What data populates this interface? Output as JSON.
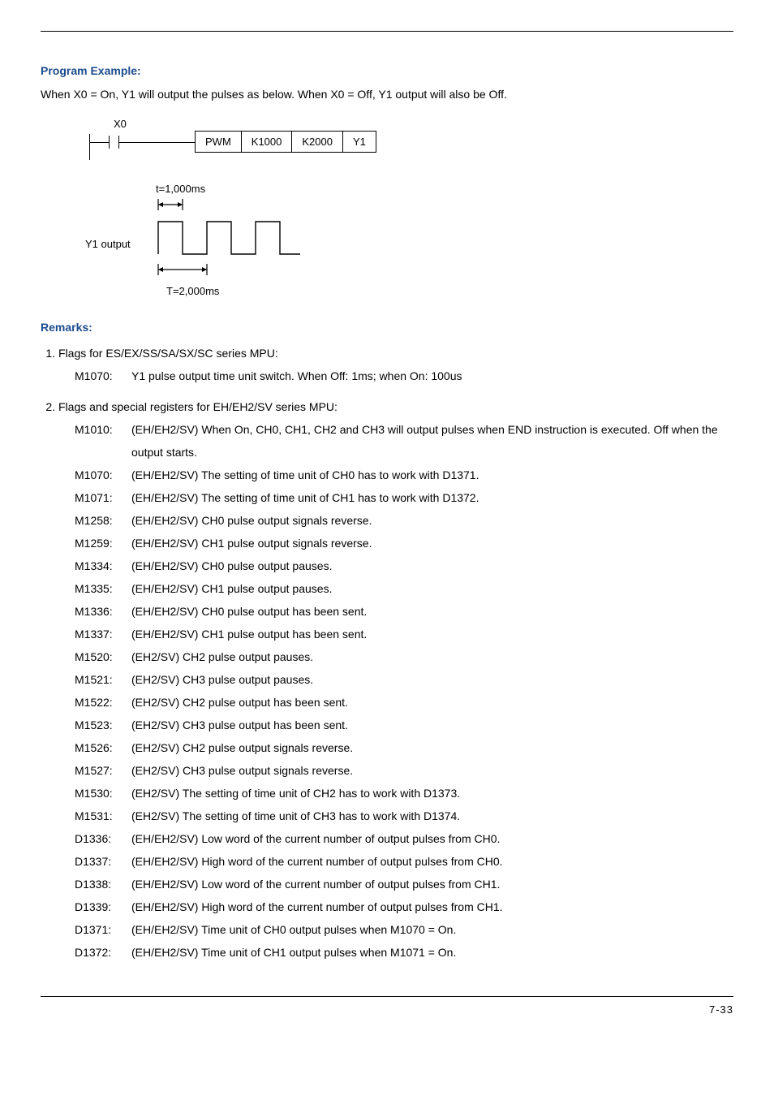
{
  "section": {
    "example_heading": "Program Example:",
    "intro_text": "When X0 = On, Y1 will output the pulses as below. When X0 = Off, Y1 output will also be Off.",
    "remarks_heading": "Remarks:"
  },
  "ladder": {
    "x0_label": "X0",
    "cells": [
      "PWM",
      "K1000",
      "K2000",
      "Y1"
    ]
  },
  "timing": {
    "t1_label": "t=1,000ms",
    "t2_label": "T=2,000ms",
    "y1_output_label": "Y1 output"
  },
  "remarks": {
    "item1_intro": "Flags for ES/EX/SS/SA/SX/SC series MPU:",
    "item1_flags": [
      {
        "id": "M1070:",
        "text": "Y1 pulse output time unit switch. When Off: 1ms; when On: 100us"
      }
    ],
    "item2_intro": "Flags and special registers for EH/EH2/SV series MPU:",
    "item2_flags": [
      {
        "id": "M1010:",
        "text": "(EH/EH2/SV) When On, CH0, CH1, CH2 and CH3 will output pulses when END instruction is executed. Off when the output starts."
      },
      {
        "id": "M1070:",
        "text": "(EH/EH2/SV) The setting of time unit of CH0 has to work with D1371."
      },
      {
        "id": "M1071:",
        "text": "(EH/EH2/SV) The setting of time unit of CH1 has to work with D1372."
      },
      {
        "id": "M1258:",
        "text": "(EH/EH2/SV) CH0 pulse output signals reverse."
      },
      {
        "id": "M1259:",
        "text": "(EH/EH2/SV) CH1 pulse output signals reverse."
      },
      {
        "id": "M1334:",
        "text": "(EH/EH2/SV) CH0 pulse output pauses."
      },
      {
        "id": "M1335:",
        "text": "(EH/EH2/SV) CH1 pulse output pauses."
      },
      {
        "id": "M1336:",
        "text": "(EH/EH2/SV) CH0 pulse output has been sent."
      },
      {
        "id": "M1337:",
        "text": "(EH/EH2/SV) CH1 pulse output has been sent."
      },
      {
        "id": "M1520:",
        "text": "(EH2/SV) CH2 pulse output pauses."
      },
      {
        "id": "M1521:",
        "text": "(EH2/SV) CH3 pulse output pauses."
      },
      {
        "id": "M1522:",
        "text": "(EH2/SV) CH2 pulse output has been sent."
      },
      {
        "id": "M1523:",
        "text": "(EH2/SV) CH3 pulse output has been sent."
      },
      {
        "id": "M1526:",
        "text": "(EH2/SV) CH2 pulse output signals reverse."
      },
      {
        "id": "M1527:",
        "text": "(EH2/SV) CH3 pulse output signals reverse."
      },
      {
        "id": "M1530:",
        "text": "(EH2/SV) The setting of time unit of CH2 has to work with D1373."
      },
      {
        "id": "M1531:",
        "text": "(EH2/SV) The setting of time unit of CH3 has to work with D1374."
      },
      {
        "id": "D1336:",
        "text": "(EH/EH2/SV) Low word of the current number of output pulses from CH0."
      },
      {
        "id": "D1337:",
        "text": "(EH/EH2/SV) High word of the current number of output pulses from CH0."
      },
      {
        "id": "D1338:",
        "text": "(EH/EH2/SV) Low word of the current number of output pulses from CH1."
      },
      {
        "id": "D1339:",
        "text": "(EH/EH2/SV) High word of the current number of output pulses from CH1."
      },
      {
        "id": "D1371:",
        "text": "(EH/EH2/SV) Time unit of CH0 output pulses when M1070 = On."
      },
      {
        "id": "D1372:",
        "text": "(EH/EH2/SV) Time unit of CH1 output pulses when M1071 = On."
      }
    ]
  },
  "page_number": "7-33"
}
